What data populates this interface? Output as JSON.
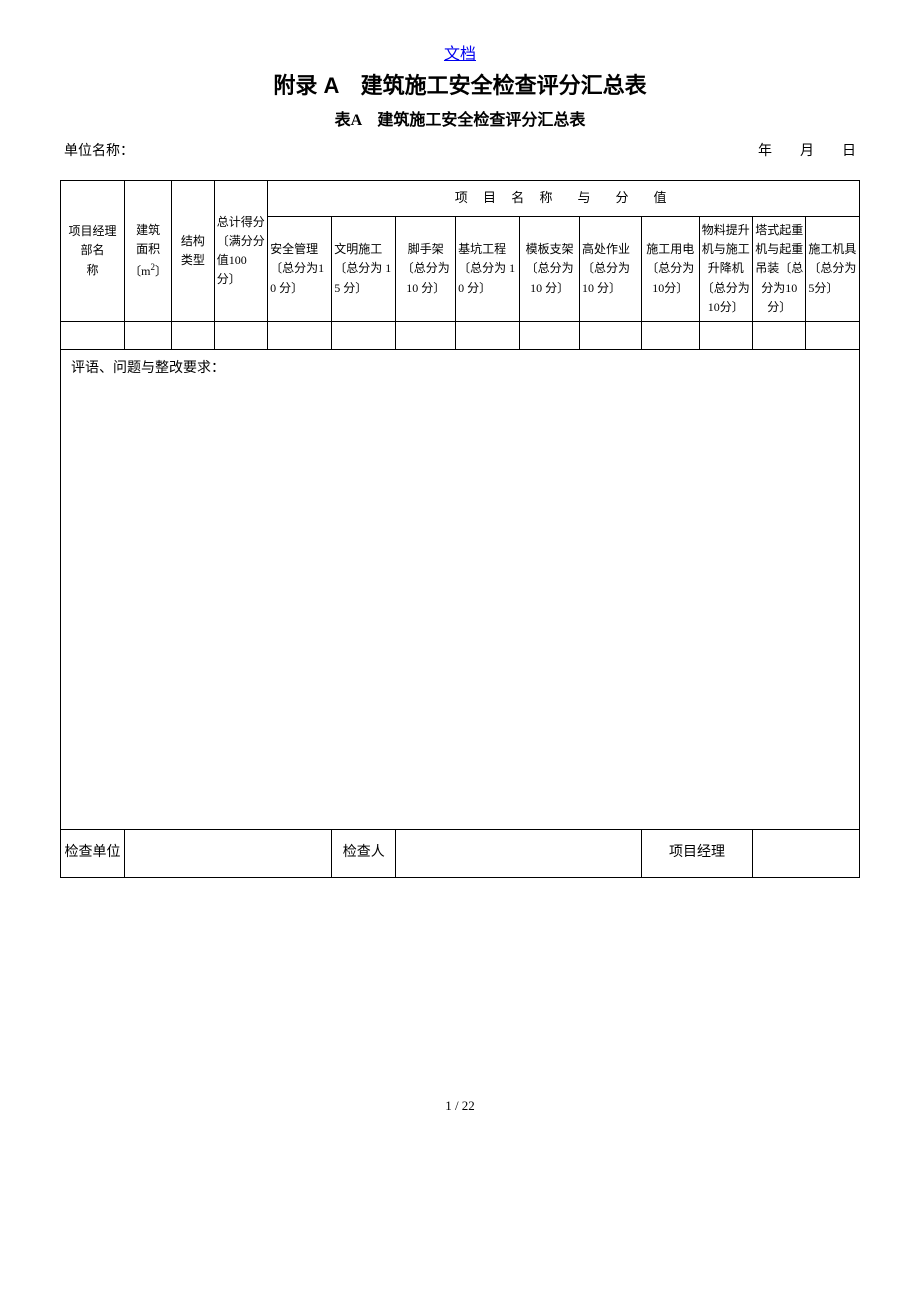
{
  "header": {
    "doc_link": "文档",
    "title": "附录 A　建筑施工安全检查评分汇总表",
    "subtitle": "表A　建筑施工安全检查评分汇总表",
    "unit_label": "单位名称：",
    "date_label": "年　　月　　日"
  },
  "table": {
    "group_header": "项 目 名 称　与　分　值",
    "row_headers": {
      "c1": "项目经理部名　　称",
      "c2_line1": "建筑",
      "c2_line2": "面积",
      "c2_line3": "〔m",
      "c2_line3_sup": "2",
      "c2_line3_end": "〕",
      "c3_line1": "结构",
      "c3_line2": "类型",
      "c4": "总计得分〔满分分值100 分〕"
    },
    "sub_headers": {
      "s1": "安全管理〔总分为10 分〕",
      "s2": "文明施工〔总分为 15 分〕",
      "s3": "脚手架〔总分为 10 分〕",
      "s4": "基坑工程〔总分为 10 分〕",
      "s5": "模板支架〔总分为 10 分〕",
      "s6": "高处作业〔总分为 10 分〕",
      "s7": "施工用电〔总分为10分〕",
      "s8": "物料提升机与施工升降机〔总分为 10分〕",
      "s9": "塔式起重机与起重吊装〔总分为10 分〕",
      "s10": "施工机具〔总分为 5分〕"
    },
    "comments_label": "评语、问题与整改要求：",
    "footer": {
      "f1": "检查单位",
      "f2": "检查人",
      "f3": "项目经理"
    }
  },
  "page_number": "1 / 22"
}
